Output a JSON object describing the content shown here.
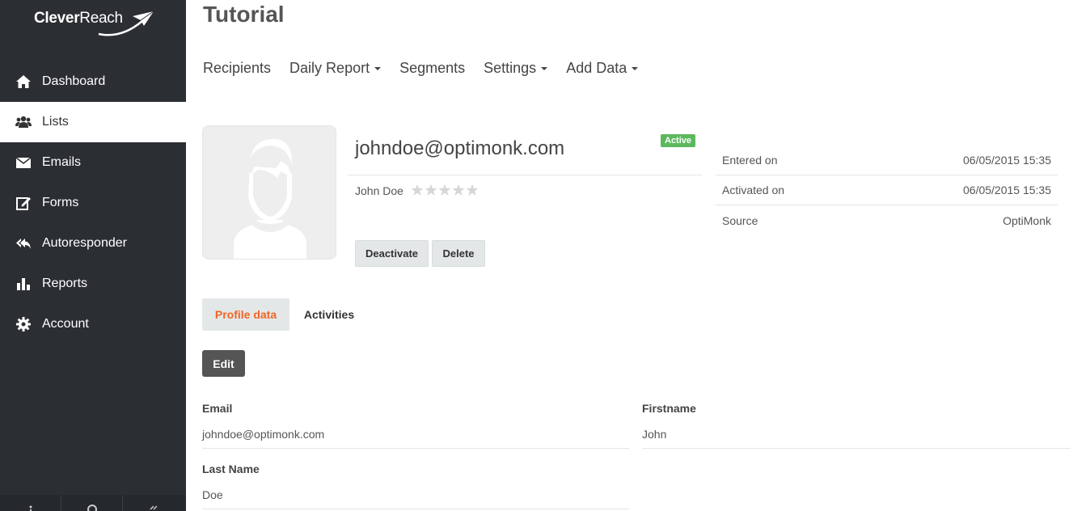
{
  "brand": {
    "name_bold": "Clever",
    "name_light": "Reach"
  },
  "sidebar": {
    "items": [
      {
        "label": "Dashboard",
        "icon": "home-icon"
      },
      {
        "label": "Lists",
        "icon": "users-icon",
        "active": true
      },
      {
        "label": "Emails",
        "icon": "envelope-icon"
      },
      {
        "label": "Forms",
        "icon": "edit-icon"
      },
      {
        "label": "Autoresponder",
        "icon": "reply-all-icon"
      },
      {
        "label": "Reports",
        "icon": "bar-chart-icon"
      },
      {
        "label": "Account",
        "icon": "gear-icon"
      }
    ],
    "bottom": [
      "info-icon",
      "help-icon",
      "collapse-icon"
    ]
  },
  "header": {
    "title": "Tutorial",
    "nav": [
      {
        "label": "Recipients",
        "dropdown": false
      },
      {
        "label": "Daily Report",
        "dropdown": true
      },
      {
        "label": "Segments",
        "dropdown": false
      },
      {
        "label": "Settings",
        "dropdown": true
      },
      {
        "label": "Add Data",
        "dropdown": true
      }
    ]
  },
  "profile": {
    "email": "johndoe@optimonk.com",
    "status": "Active",
    "name": "John Doe",
    "rating": 0,
    "rating_max": 5,
    "deactivate_label": "Deactivate",
    "delete_label": "Delete"
  },
  "info": [
    {
      "label": "Entered on",
      "value": "06/05/2015 15:35"
    },
    {
      "label": "Activated on",
      "value": "06/05/2015 15:35"
    },
    {
      "label": "Source",
      "value": "OptiMonk"
    }
  ],
  "subtabs": {
    "profile": "Profile data",
    "activities": "Activities"
  },
  "edit_label": "Edit",
  "fields": {
    "email": {
      "label": "Email",
      "value": "johndoe@optimonk.com"
    },
    "firstname": {
      "label": "Firstname",
      "value": "John"
    },
    "lastname": {
      "label": "Last Name",
      "value": "Doe"
    }
  },
  "colors": {
    "accent": "#f26522",
    "active_badge": "#5cb85c",
    "sidebar_bg": "#2b2e33"
  }
}
